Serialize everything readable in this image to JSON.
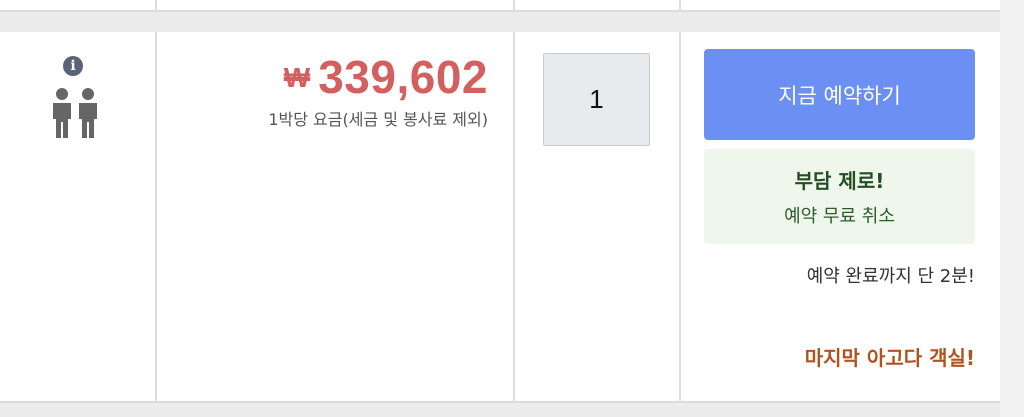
{
  "occupancy": {
    "info_icon": "info-icon",
    "info_glyph": "i",
    "guests_icon": "two-people-icon",
    "guests": 2
  },
  "price": {
    "currency": "₩",
    "amount": "339,602",
    "note": "1박당 요금(세금 및 봉사료 제외)"
  },
  "quantity": {
    "value": "1"
  },
  "booking": {
    "button_label": "지금 예약하기",
    "free_cancel_title": "부담 제로!",
    "free_cancel_sub": "예약 무료 취소",
    "two_minutes": "예약 완료까지 단 2분!",
    "last_room": "마지막 아고다 객실!"
  },
  "colors": {
    "price_red": "#d35f5f",
    "button_blue": "#6b8ff2",
    "free_box_bg": "#eff6ec",
    "free_green": "#234d22",
    "last_room_brown": "#b0531f"
  }
}
